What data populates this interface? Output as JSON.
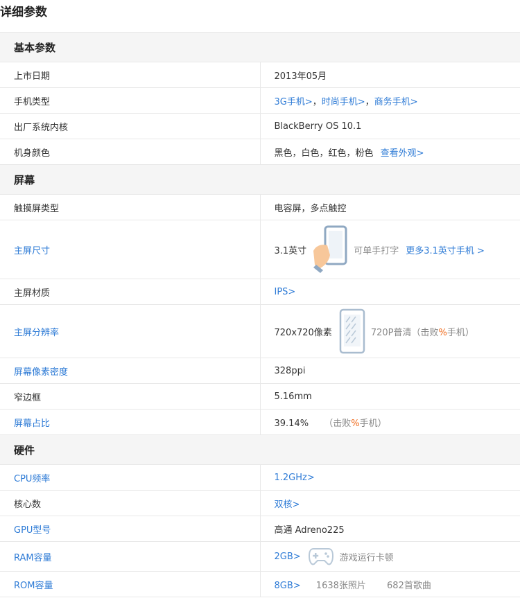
{
  "title": "详细参数",
  "sections": {
    "basic": "基本参数",
    "screen": "屏幕",
    "hardware": "硬件"
  },
  "basic": {
    "launch_date": {
      "label": "上市日期",
      "value": "2013年05月"
    },
    "phone_type": {
      "label": "手机类型",
      "links": [
        "3G手机>",
        "时尚手机>",
        "商务手机>"
      ],
      "sep": "，"
    },
    "os": {
      "label": "出厂系统内核",
      "value": "BlackBerry OS 10.1"
    },
    "colors": {
      "label": "机身颜色",
      "value": "黑色，白色，红色，粉色",
      "link": "查看外观>"
    }
  },
  "screen": {
    "touch_type": {
      "label": "触摸屏类型",
      "value": "电容屏，多点触控"
    },
    "size": {
      "label": "主屏尺寸",
      "value": "3.1英寸",
      "note": "可单手打字",
      "link": "更多3.1英寸手机 >"
    },
    "material": {
      "label": "主屏材质",
      "link": "IPS>"
    },
    "resolution": {
      "label": "主屏分辨率",
      "value": "720x720像素",
      "note_prefix": "720P普清（击败",
      "note_pct": "%",
      "note_suffix": "手机）"
    },
    "ppi": {
      "label": "屏幕像素密度",
      "value": "328ppi"
    },
    "bezel": {
      "label": "窄边框",
      "value": "5.16mm"
    },
    "ratio": {
      "label": "屏幕占比",
      "value": "39.14%",
      "note_prefix": "（击败",
      "note_pct": "%",
      "note_suffix": "手机）"
    }
  },
  "hardware": {
    "cpu": {
      "label": "CPU频率",
      "link": "1.2GHz>"
    },
    "cores": {
      "label": "核心数",
      "link": "双核>"
    },
    "gpu": {
      "label": "GPU型号",
      "value": "高通 Adreno225"
    },
    "ram": {
      "label": "RAM容量",
      "link": "2GB>",
      "note": "游戏运行卡顿"
    },
    "rom": {
      "label": "ROM容量",
      "link": "8GB>",
      "photos": "1638张照片",
      "songs": "682首歌曲"
    }
  },
  "colors": {
    "link": "#2e7bd6",
    "highlight": "#f06a1b",
    "section_bg": "#f5f5f5"
  }
}
